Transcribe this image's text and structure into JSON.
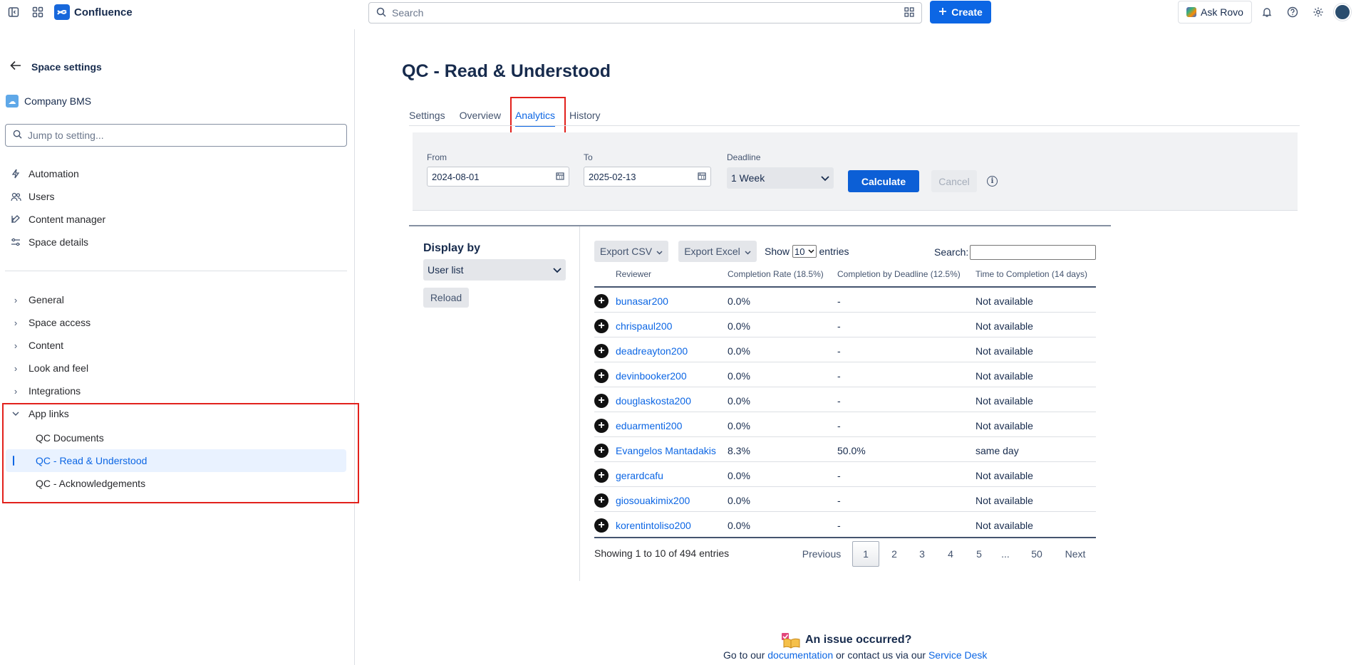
{
  "topbar": {
    "app_name": "Confluence",
    "search_placeholder": "Search",
    "create_label": "Create",
    "rovo_label": "Ask Rovo"
  },
  "sidebar": {
    "title": "Space settings",
    "space_name": "Company BMS",
    "jump_placeholder": "Jump to setting...",
    "items": [
      {
        "label": "Automation",
        "icon": "lightning-icon"
      },
      {
        "label": "Users",
        "icon": "users-icon"
      },
      {
        "label": "Content manager",
        "icon": "content-manager-icon"
      },
      {
        "label": "Space details",
        "icon": "sliders-icon"
      }
    ],
    "groups": [
      {
        "label": "General"
      },
      {
        "label": "Space access"
      },
      {
        "label": "Content"
      },
      {
        "label": "Look and feel"
      },
      {
        "label": "Integrations"
      },
      {
        "label": "App links"
      }
    ],
    "app_links": [
      {
        "label": "QC Documents"
      },
      {
        "label": "QC - Read & Understood"
      },
      {
        "label": "QC - Acknowledgements"
      }
    ]
  },
  "main": {
    "title": "QC - Read & Understood",
    "tabs": [
      {
        "label": "Settings"
      },
      {
        "label": "Overview"
      },
      {
        "label": "Analytics"
      },
      {
        "label": "History"
      }
    ],
    "filters": {
      "from_label": "From",
      "from_value": "2024-08-01",
      "to_label": "To",
      "to_value": "2025-02-13",
      "deadline_label": "Deadline",
      "deadline_value": "1 Week",
      "calculate_label": "Calculate",
      "cancel_label": "Cancel"
    },
    "display_by": {
      "label": "Display by",
      "value": "User list",
      "reload_label": "Reload"
    },
    "table_controls": {
      "export_csv": "Export CSV",
      "export_excel": "Export Excel",
      "show_label": "Show",
      "entries_value": "10",
      "entries_label": "entries",
      "search_label": "Search:"
    },
    "table": {
      "headers": [
        "Reviewer",
        "Completion Rate (18.5%)",
        "Completion by Deadline (12.5%)",
        "Time to Completion (14 days)"
      ],
      "rows": [
        [
          "bunasar200",
          "0.0%",
          "-",
          "Not available"
        ],
        [
          "chrispaul200",
          "0.0%",
          "-",
          "Not available"
        ],
        [
          "deadreayton200",
          "0.0%",
          "-",
          "Not available"
        ],
        [
          "devinbooker200",
          "0.0%",
          "-",
          "Not available"
        ],
        [
          "douglaskosta200",
          "0.0%",
          "-",
          "Not available"
        ],
        [
          "eduarmenti200",
          "0.0%",
          "-",
          "Not available"
        ],
        [
          "Evangelos Mantadakis",
          "8.3%",
          "50.0%",
          "same day"
        ],
        [
          "gerardcafu",
          "0.0%",
          "-",
          "Not available"
        ],
        [
          "giosouakimix200",
          "0.0%",
          "-",
          "Not available"
        ],
        [
          "korentintoliso200",
          "0.0%",
          "-",
          "Not available"
        ]
      ]
    },
    "pagination": {
      "summary": "Showing 1 to 10 of 494 entries",
      "previous": "Previous",
      "pages": [
        "1",
        "2",
        "3",
        "4",
        "5",
        "...",
        "50"
      ],
      "next": "Next"
    },
    "footer": {
      "title": "An issue occurred?",
      "text_before": "Go to our",
      "doc_link": "documentation",
      "text_middle": "or contact us via our",
      "desk_link": "Service Desk"
    }
  },
  "colors": {
    "accent": "#0c66e4",
    "highlight_box": "#e2211c"
  }
}
